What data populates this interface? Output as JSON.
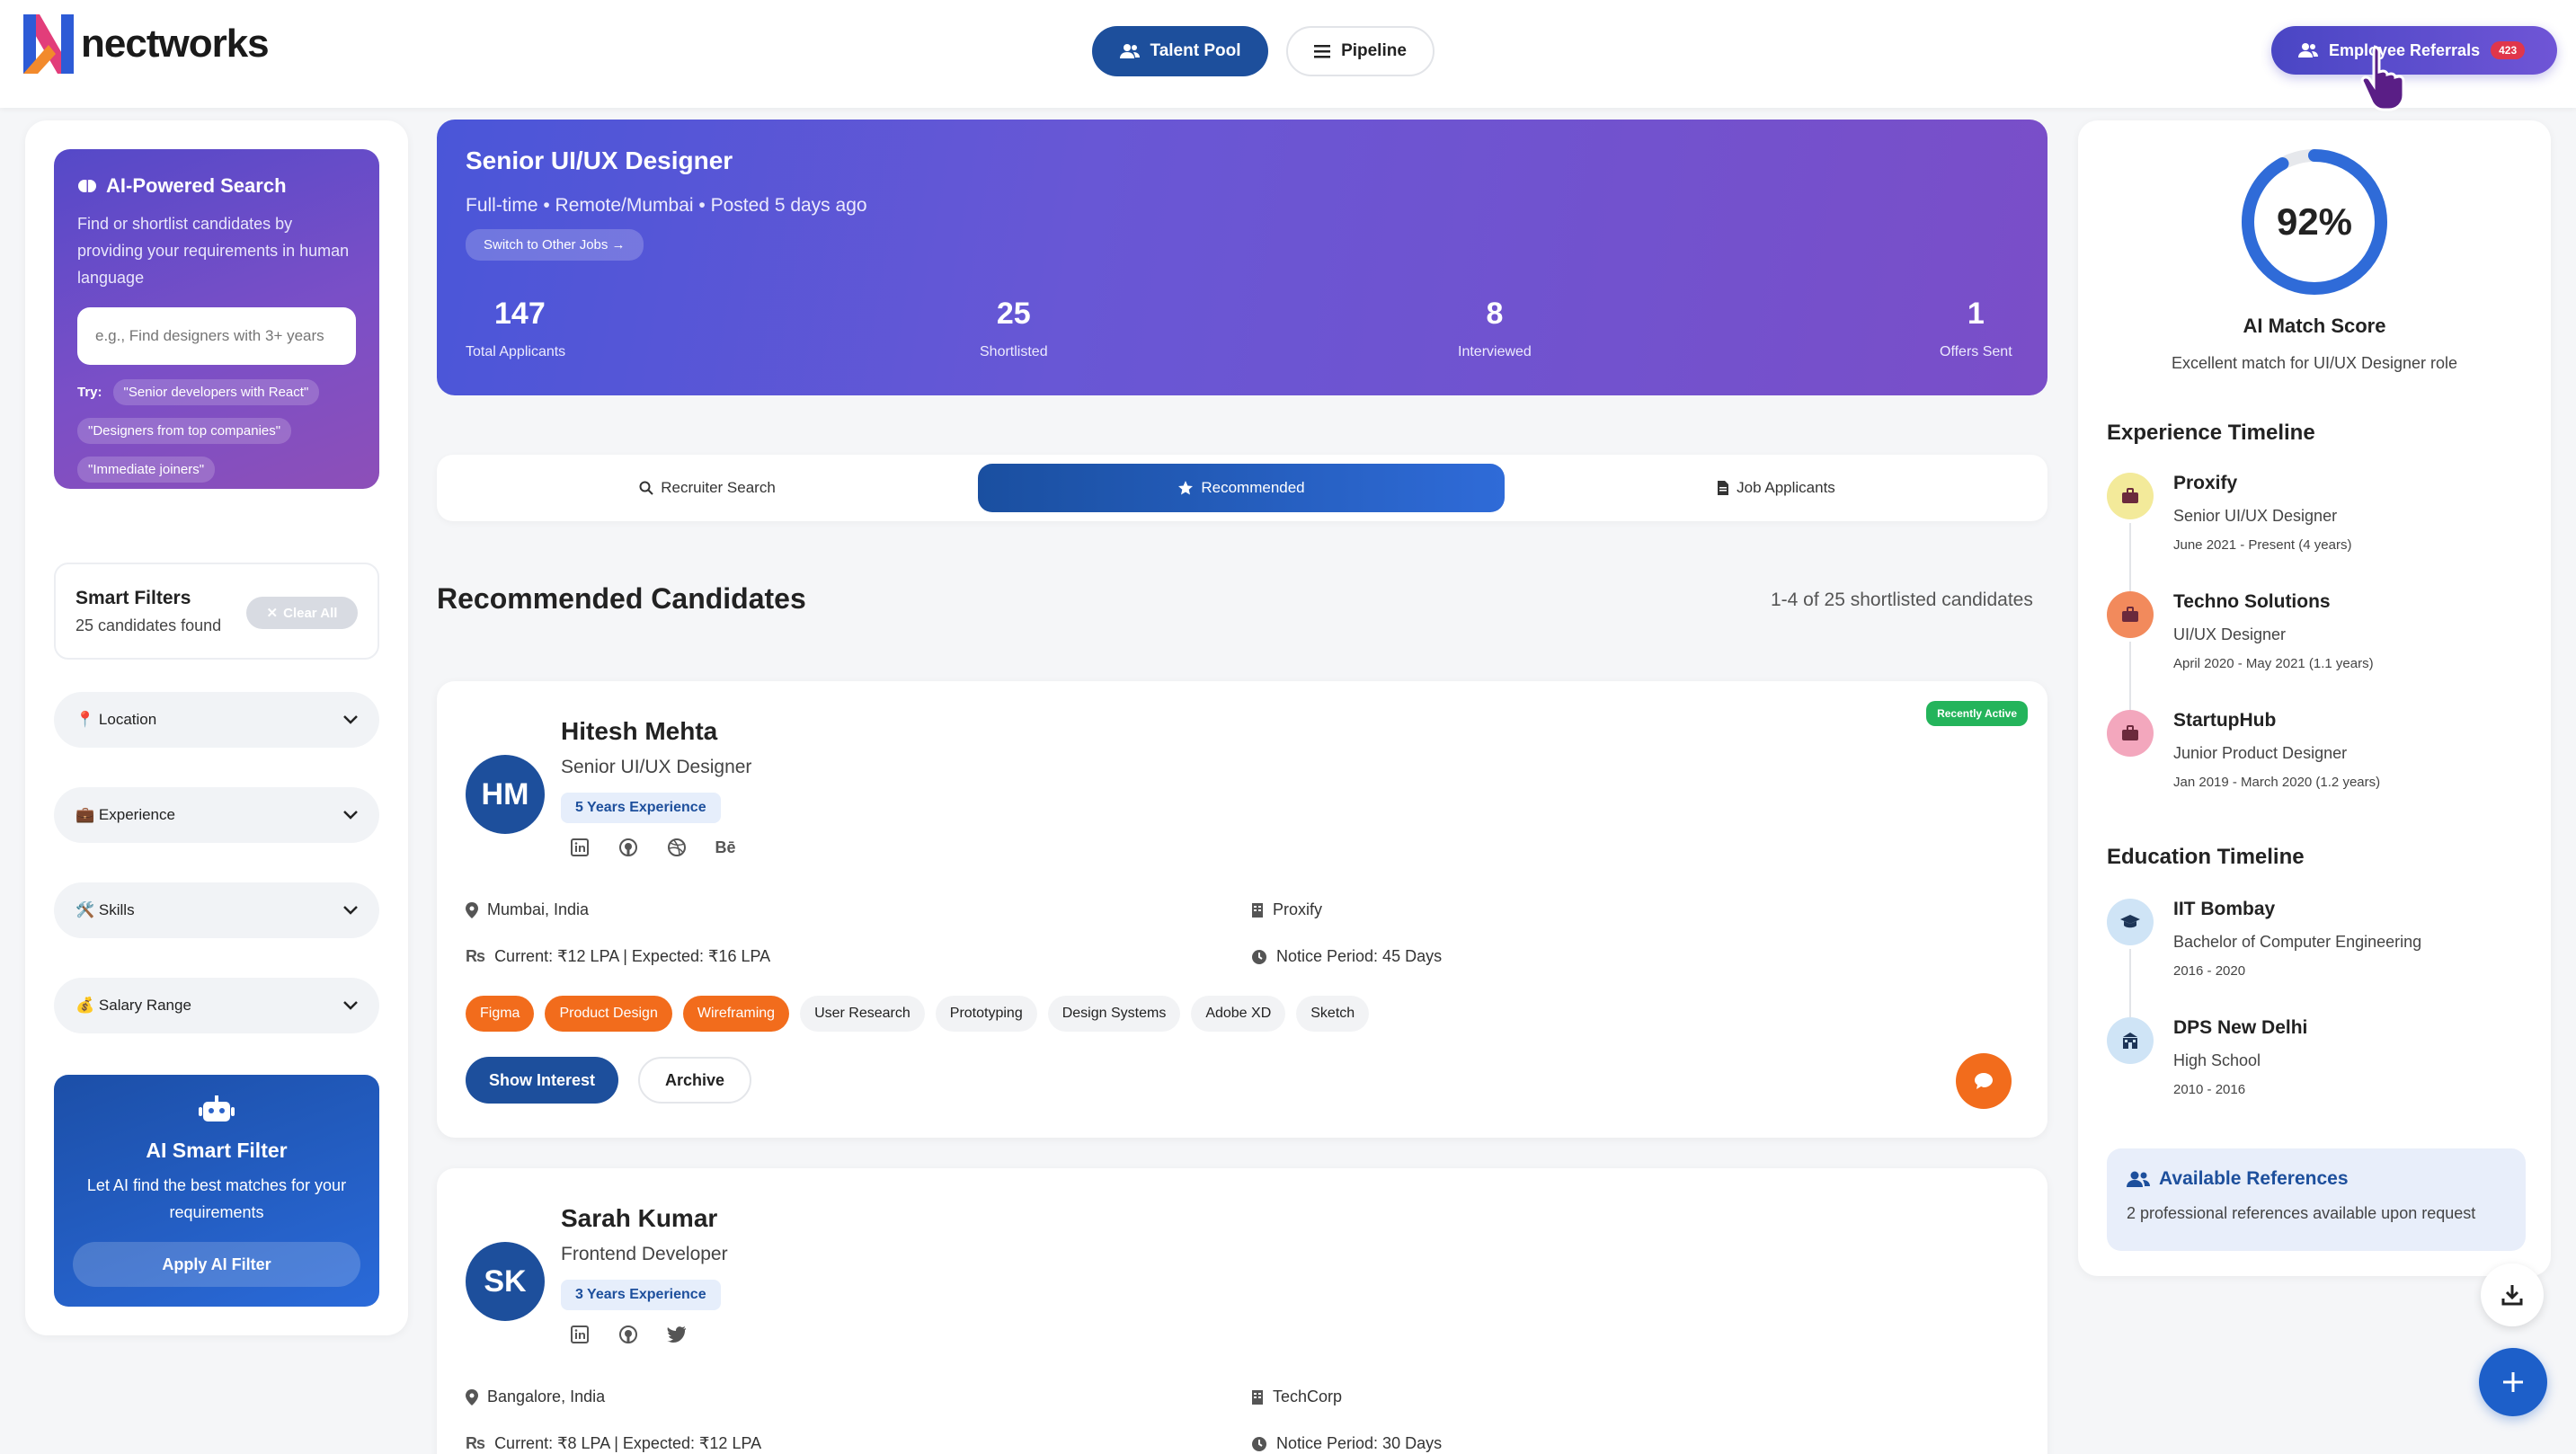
{
  "app": {
    "logo_text": "nectworks"
  },
  "header": {
    "tabs": [
      {
        "label": "Talent Pool",
        "active": true
      },
      {
        "label": "Pipeline",
        "active": false
      }
    ],
    "referrals_label": "Employee Referrals",
    "referrals_count": "423"
  },
  "sidebar": {
    "ai_search": {
      "title": "AI-Powered Search",
      "description": "Find or shortlist candidates by providing your requirements in human language",
      "placeholder": "e.g., Find designers with 3+ years",
      "try_label": "Try:",
      "suggestions": [
        "\"Senior developers with React\"",
        "\"Designers from top companies\"",
        "\"Immediate joiners\""
      ]
    },
    "smart_filters": {
      "title": "Smart Filters",
      "count_text": "25 candidates found",
      "clear_label": "Clear All"
    },
    "filters": [
      {
        "icon": "📍",
        "label": "Location"
      },
      {
        "icon": "💼",
        "label": "Experience"
      },
      {
        "icon": "🛠️",
        "label": "Skills"
      },
      {
        "icon": "💰",
        "label": "Salary Range"
      }
    ],
    "ai_smart_filter": {
      "title": "AI Smart Filter",
      "description": "Let AI find the best matches for your requirements",
      "button": "Apply AI Filter"
    }
  },
  "job": {
    "title": "Senior UI/UX Designer",
    "meta": "Full-time • Remote/Mumbai • Posted 5 days ago",
    "switch_label": "Switch to Other Jobs →",
    "stats": [
      {
        "value": "147",
        "label": "Total Applicants"
      },
      {
        "value": "25",
        "label": "Shortlisted"
      },
      {
        "value": "8",
        "label": "Interviewed"
      },
      {
        "value": "1",
        "label": "Offers Sent"
      }
    ]
  },
  "tabs": [
    {
      "label": "Recruiter Search",
      "icon": "search-icon",
      "active": false
    },
    {
      "label": "Recommended",
      "icon": "star-icon",
      "active": true
    },
    {
      "label": "Job Applicants",
      "icon": "document-icon",
      "active": false
    }
  ],
  "results": {
    "title": "Recommended Candidates",
    "count": "1-4 of 25 shortlisted candidates"
  },
  "candidates": [
    {
      "initials": "HM",
      "name": "Hitesh Mehta",
      "role": "Senior UI/UX Designer",
      "experience": "5 Years Experience",
      "badge": "Recently Active",
      "location": "Mumbai, India",
      "company": "Proxify",
      "salary": "Current: ₹12 LPA | Expected: ₹16 LPA",
      "notice": "Notice Period: 45 Days",
      "skills": [
        {
          "name": "Figma",
          "highlight": true
        },
        {
          "name": "Product Design",
          "highlight": true
        },
        {
          "name": "Wireframing",
          "highlight": true
        },
        {
          "name": "User Research",
          "highlight": false
        },
        {
          "name": "Prototyping",
          "highlight": false
        },
        {
          "name": "Design Systems",
          "highlight": false
        },
        {
          "name": "Adobe XD",
          "highlight": false
        },
        {
          "name": "Sketch",
          "highlight": false
        }
      ],
      "actions": {
        "primary": "Show Interest",
        "secondary": "Archive"
      }
    },
    {
      "initials": "SK",
      "name": "Sarah Kumar",
      "role": "Frontend Developer",
      "experience": "3 Years Experience",
      "location": "Bangalore, India",
      "company": "TechCorp",
      "salary": "Current: ₹8 LPA | Expected: ₹12 LPA",
      "notice": "Notice Period: 30 Days"
    }
  ],
  "profile": {
    "match_score": "92%",
    "match_percent": 92,
    "match_title": "AI Match Score",
    "match_sub": "Excellent match for UI/UX Designer role",
    "experience_title": "Experience Timeline",
    "experience": [
      {
        "company": "Proxify",
        "role": "Senior UI/UX Designer",
        "dates": "June 2021 - Present (4 years)",
        "color": "#f3ea9a"
      },
      {
        "company": "Techno Solutions",
        "role": "UI/UX Designer",
        "dates": "April 2020 - May 2021 (1.1 years)",
        "color": "#f28a5c"
      },
      {
        "company": "StartupHub",
        "role": "Junior Product Designer",
        "dates": "Jan 2019 - March 2020 (1.2 years)",
        "color": "#f3a7bd"
      }
    ],
    "education_title": "Education Timeline",
    "education": [
      {
        "school": "IIT Bombay",
        "degree": "Bachelor of Computer Engineering",
        "dates": "2016 - 2020"
      },
      {
        "school": "DPS New Delhi",
        "degree": "High School",
        "dates": "2010 - 2016"
      }
    ],
    "references": {
      "title": "Available References",
      "sub": "2 professional references available upon request"
    }
  },
  "colors": {
    "primary": "#1d4f9c",
    "accent_orange": "#f26c1c",
    "success": "#24b45b",
    "banner_start": "#4a56d8",
    "banner_end": "#7a4ec8"
  }
}
